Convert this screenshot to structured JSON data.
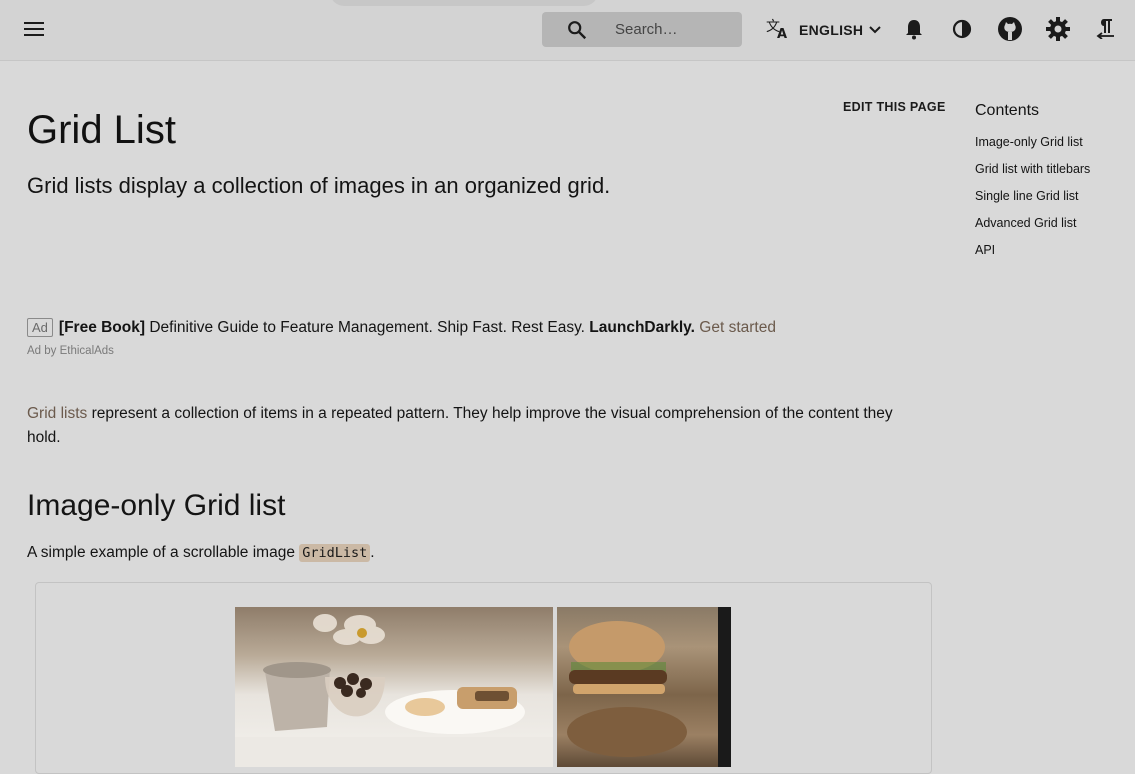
{
  "header": {
    "search_placeholder": "Search…",
    "language_label": "ENGLISH",
    "icons": [
      "menu-icon",
      "search-icon",
      "translate-icon",
      "chevron-down-icon",
      "bell-icon",
      "contrast-icon",
      "github-icon",
      "gear-icon",
      "rtl-icon"
    ]
  },
  "page": {
    "edit_label": "EDIT THIS PAGE",
    "title": "Grid List",
    "subtitle": "Grid lists display a collection of images in an organized grid."
  },
  "ad": {
    "badge": "Ad",
    "bold_prefix": "[Free Book]",
    "text": " Definitive Guide to Feature Management. Ship Fast. Rest Easy. ",
    "brand": "LaunchDarkly.",
    "cta": "Get started",
    "by_line": "Ad by EthicalAds"
  },
  "intro": {
    "link": "Grid lists",
    "text": " represent a collection of items in a repeated pattern. They help improve the visual comprehension of the content they hold."
  },
  "section": {
    "heading": "Image-only Grid list",
    "text_before": "A simple example of a scrollable image ",
    "code": "GridList",
    "text_after": "."
  },
  "toc": {
    "title": "Contents",
    "items": [
      "Image-only Grid list",
      "Grid list with titlebars",
      "Single line Grid list",
      "Advanced Grid list",
      "API"
    ]
  },
  "colors": {
    "link": "#6b5a4c",
    "code_bg": "#cbb9a5",
    "page_bg": "#d9d9d9"
  }
}
